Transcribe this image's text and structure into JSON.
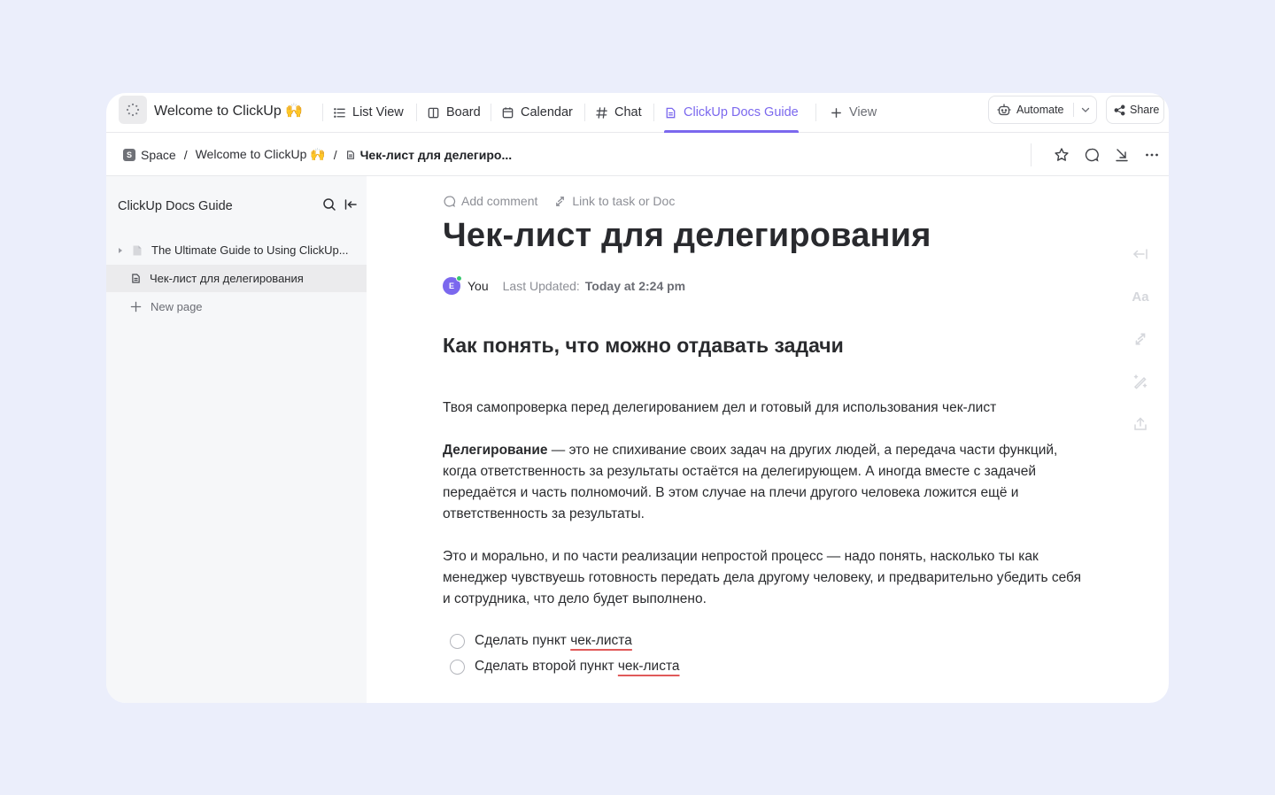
{
  "topbar": {
    "space_title": "Welcome to ClickUp 🙌",
    "tabs": [
      {
        "label": "List View",
        "icon": "list-icon"
      },
      {
        "label": "Board",
        "icon": "board-icon"
      },
      {
        "label": "Calendar",
        "icon": "calendar-icon"
      },
      {
        "label": "Chat",
        "icon": "hash-icon"
      },
      {
        "label": "ClickUp Docs Guide",
        "icon": "doc-icon",
        "active": true
      }
    ],
    "add_view_label": "View",
    "automate_label": "Automate",
    "share_label": "Share",
    "accent_color": "#7b68ee"
  },
  "breadcrumb": {
    "space_badge": "S",
    "space": "Space",
    "folder": "Welcome to ClickUp 🙌",
    "current": "Чек-лист для делегиро..."
  },
  "sidebar": {
    "title": "ClickUp Docs Guide",
    "items": [
      {
        "label": "The Ultimate Guide to Using ClickUp..."
      },
      {
        "label": "Чек-лист для делегирования",
        "selected": true
      }
    ],
    "new_page_label": "New page"
  },
  "doc": {
    "add_comment": "Add comment",
    "link_task": "Link to task or Doc",
    "title": "Чек-лист для делегирования",
    "author_initial": "E",
    "author": "You",
    "last_updated_label": "Last Updated:",
    "last_updated_value": "Today at 2:24 pm",
    "heading": "Как понять, что можно отдавать задачи",
    "intro": "Твоя самопроверка перед делегированием дел и готовый для использования чек-лист",
    "para1_bold": "Делегирование",
    "para1_rest": " — это не спихивание своих задач на других людей, а передача части функций, когда ответственность за результаты остаётся на делегирующем. А иногда вместе с задачей передаётся и часть полномочий. В этом случае на плечи другого человека ложится ещё и ответственность за результаты.",
    "para2": "Это и морально, и по части реализации непростой процесс — надо понять, насколько ты как менеджер чувствуешь готовность передать дела другому человеку, и предварительно убедить себя и сотрудника, что дело будет выполнено.",
    "checklist": [
      {
        "prefix": "Сделать пункт ",
        "flagged": "чек-листа",
        "checked": false
      },
      {
        "prefix": "Сделать второй пункт ",
        "flagged": "чек-листа",
        "checked": false
      }
    ],
    "right_tools": {
      "typography_label": "Aa"
    }
  }
}
